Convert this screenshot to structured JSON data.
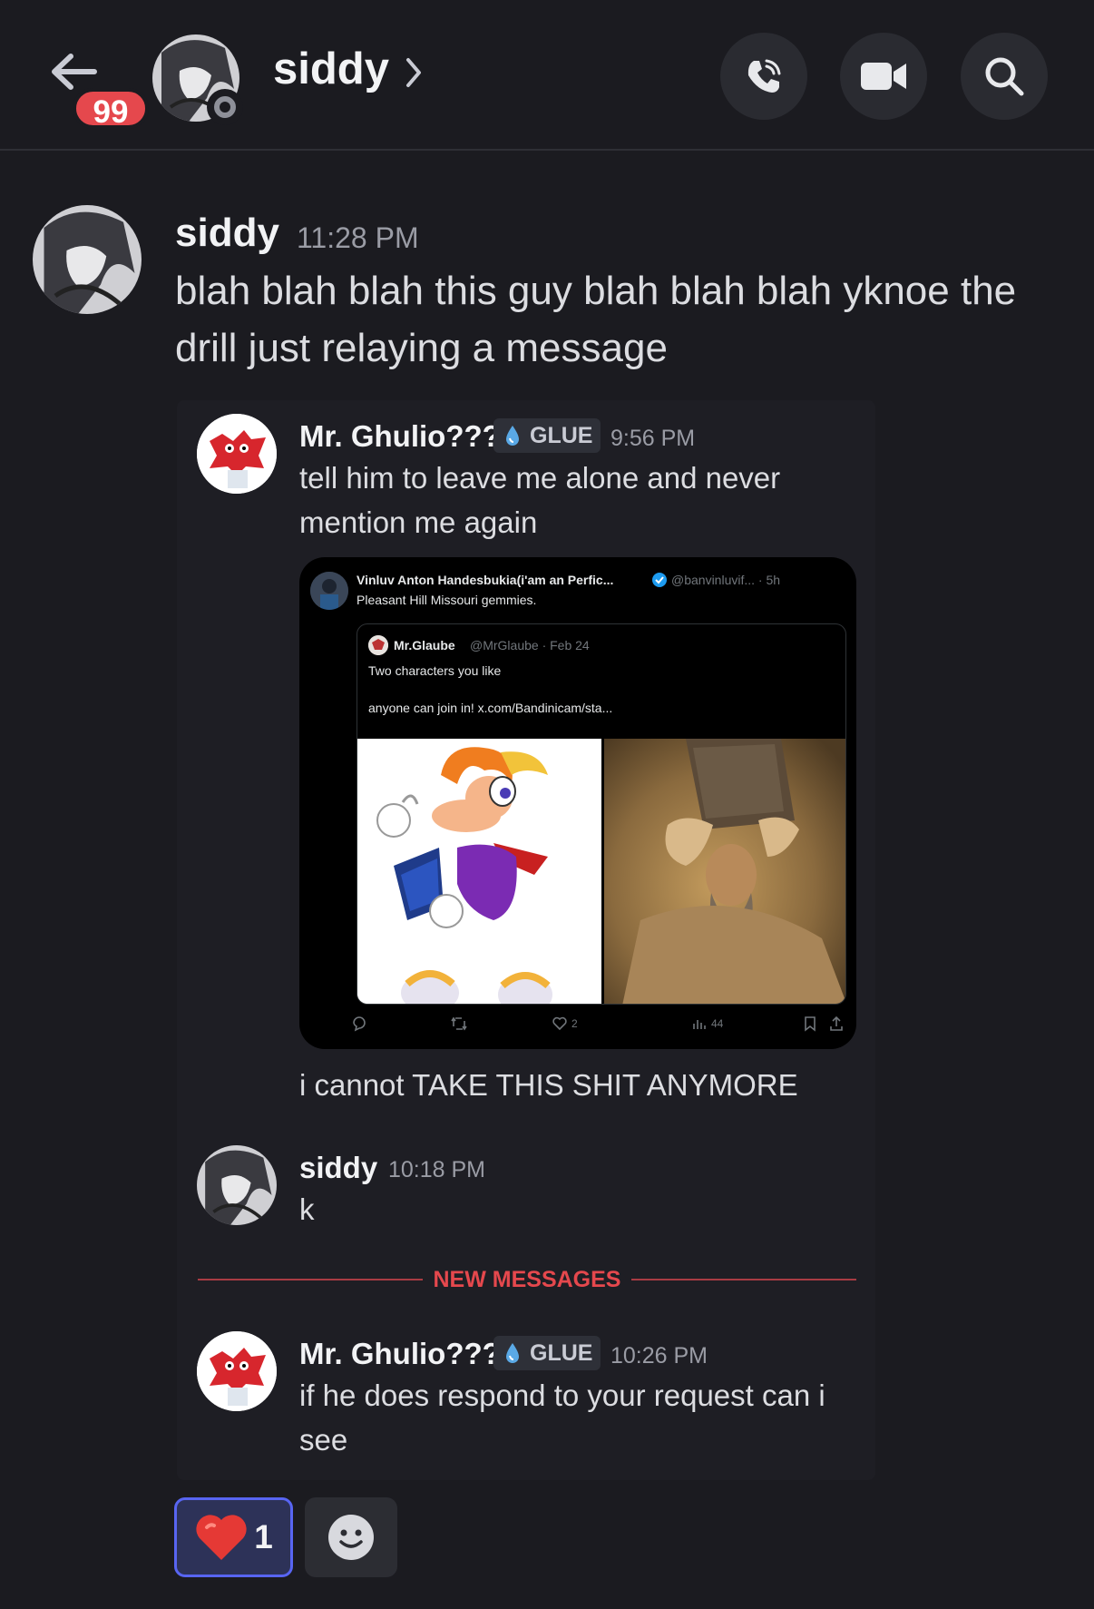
{
  "header": {
    "title": "siddy",
    "unread_badge": "99"
  },
  "messages": {
    "first": {
      "author": "siddy",
      "time": "11:28 PM",
      "line1": "blah blah blah this guy blah blah blah yknoe the",
      "line2": "drill just relaying a message"
    },
    "quote1": {
      "author": "Mr. Ghulio???",
      "tag": "GLUE",
      "time": "9:56 PM",
      "line1": "tell him to leave me alone and never",
      "line2": "mention me again",
      "after_embed": "i cannot TAKE THIS SHIT ANYMORE"
    },
    "quote2": {
      "author": "siddy",
      "time": "10:18 PM",
      "text": "k"
    },
    "divider_label": "NEW MESSAGES",
    "quote3": {
      "author": "Mr. Ghulio???",
      "tag": "GLUE",
      "time": "10:26 PM",
      "line1": "if he does respond to your request can i",
      "line2": "see"
    }
  },
  "embed": {
    "tweet_name": "Vinluv Anton Handesbukia(i'am an Perfic...",
    "tweet_handle": "@banvinluvif... · 5h",
    "tweet_text": "Pleasant Hill Missouri gemmies.",
    "quoted_name": "Mr.Glaube",
    "quoted_handle": "@MrGlaube · Feb 24",
    "quoted_line1": "Two characters you like",
    "quoted_line2": "anyone can join in! x.com/Bandinicam/sta...",
    "likes": "2",
    "views": "44"
  },
  "reactions": {
    "heart_emoji": "❤️",
    "heart_count": "1"
  },
  "colors": {
    "background": "#1b1b20",
    "accent": "#5865f2",
    "new_messages": "#e5484d"
  }
}
